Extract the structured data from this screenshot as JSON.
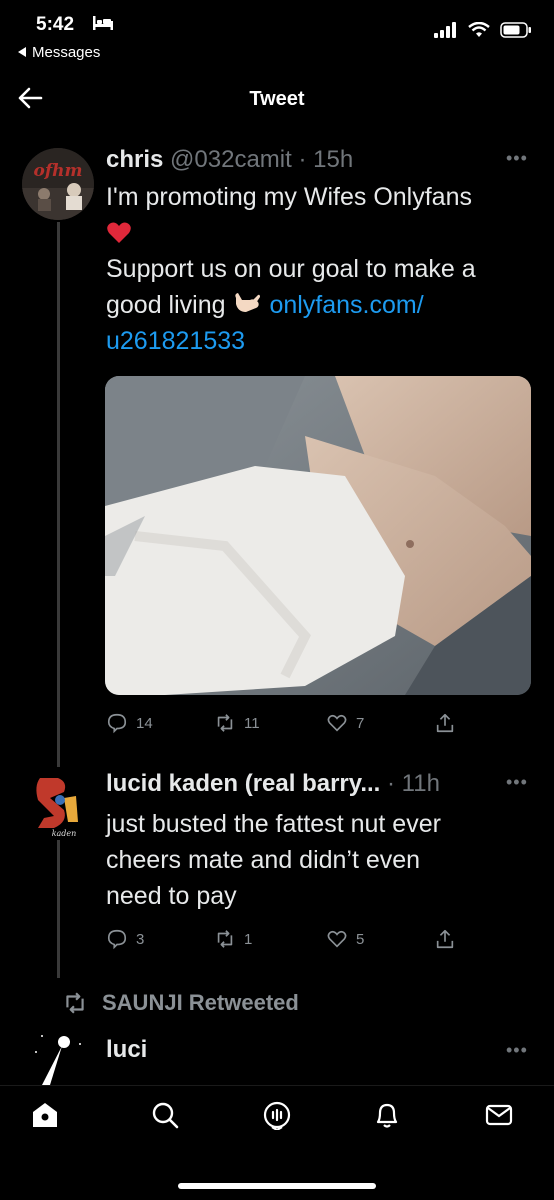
{
  "status": {
    "time": "5:42",
    "back_app": "Messages"
  },
  "header": {
    "title": "Tweet"
  },
  "main_tweet": {
    "name": "chris",
    "handle": "@032camit",
    "age": "15h",
    "text_line1": "I'm promoting my Wifes Onlyfans",
    "emoji1": "❤️",
    "text_line2": "Support us on our goal to make a",
    "text_line3": "good living",
    "emoji2": "🤙🏻",
    "link_part1": "onlyfans.com/",
    "link_part2": "u261821533",
    "replies": "14",
    "retweets": "11",
    "likes": "7"
  },
  "reply_tweet": {
    "name": "lucid kaden (real barry...",
    "age": "11h",
    "avatar_caption": "kaden",
    "text_line1": "just busted the fattest nut ever",
    "text_line2": "cheers mate and didn’t even",
    "text_line3": "need to pay",
    "replies": "3",
    "retweets": "1",
    "likes": "5"
  },
  "retweet_banner": {
    "label": "SAUNJI Retweeted"
  },
  "next_tweet": {
    "name": "luci"
  },
  "icons": {
    "more": "more-icon",
    "reply": "reply-icon",
    "retweet": "retweet-icon",
    "like": "heart-icon",
    "share": "share-icon"
  },
  "colors": {
    "link": "#1d9bf0",
    "muted": "#71767b",
    "background": "#000000"
  }
}
